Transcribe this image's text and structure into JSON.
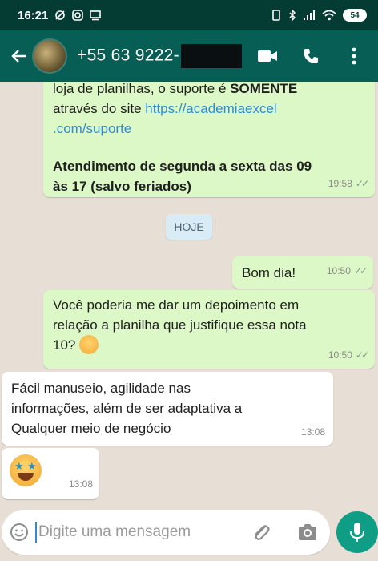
{
  "status_bar": {
    "time": "16:21",
    "battery": "54"
  },
  "header": {
    "contact_number": "+55 63 9222-"
  },
  "messages": [
    {
      "type": "outgoing",
      "line1_prefix": "loja de planilhas, o suporte é ",
      "line1_bold": "SOMENTE",
      "line2_prefix": "através do site ",
      "link_part1": "https://academiaexcel",
      "link_part2": ".com/suporte",
      "bold_line1": "Atendimento de segunda a sexta das 09",
      "bold_line2": "às 17 (salvo feriados)",
      "time": "19:58"
    },
    {
      "type": "outgoing",
      "text": "Bom dia!",
      "time": "10:50"
    },
    {
      "type": "outgoing",
      "line1": "Você poderia me dar um depoimento em",
      "line2": "relação a planilha que justifique essa nota",
      "line3": "10?",
      "time": "10:50"
    },
    {
      "type": "incoming",
      "line1": "Fácil manuseio, agilidade nas",
      "line2": "informações, além de ser adaptativa a",
      "line3": "Qualquer meio de negócio",
      "time": "13:08"
    },
    {
      "type": "incoming",
      "emoji": "star-struck-emoji",
      "time": "13:08"
    }
  ],
  "date_divider": "HOJE",
  "composer": {
    "placeholder": "Digite uma mensagem"
  },
  "colors": {
    "header": "#075e54",
    "status_bar": "#043b33",
    "outgoing_bubble": "#dcf8c6",
    "incoming_bubble": "#ffffff",
    "mic_button": "#0f9d86",
    "link": "#2f8bd6"
  }
}
